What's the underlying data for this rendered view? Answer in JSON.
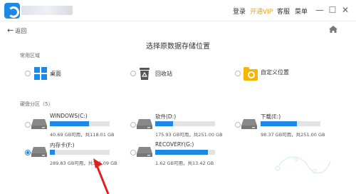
{
  "titlebar": {
    "menus": [
      "登录",
      "开通VIP",
      "客服",
      "菜单"
    ],
    "vip_color": "#f0a400"
  },
  "nav": {
    "back_label": "返回"
  },
  "page_title": "选择原数据存储位置",
  "common": {
    "section_label": "常用区域",
    "items": [
      {
        "label": "桌面",
        "icon": "windows-icon"
      },
      {
        "label": "回收站",
        "icon": "recycle-bin-icon"
      },
      {
        "label": "自定义位置",
        "icon": "folder-search-icon"
      }
    ]
  },
  "disks": {
    "section_label": "硬盘分区（5）",
    "items": [
      {
        "name": "WINDOWS(C:)",
        "info": "40.69 GB可用，共118.01 GB",
        "used_fraction": 0.66,
        "selected": false
      },
      {
        "name": "软件(D:)",
        "info": "175.93 GB可用，共251.00 GB",
        "used_fraction": 0.3,
        "selected": false
      },
      {
        "name": "下载(E:)",
        "info": "98.37 GB可用，共251.00 GB",
        "used_fraction": 0.61,
        "selected": false
      },
      {
        "name": "内存卡(F:)",
        "info": "289.83 GB可用，共315.09 GB",
        "used_fraction": 0.08,
        "selected": true
      },
      {
        "name": "RECOVERY(G:)",
        "info": "1.62 GB可用，共13.42 GB",
        "used_fraction": 0.88,
        "selected": false
      }
    ]
  },
  "accent_color": "#1e88e5"
}
